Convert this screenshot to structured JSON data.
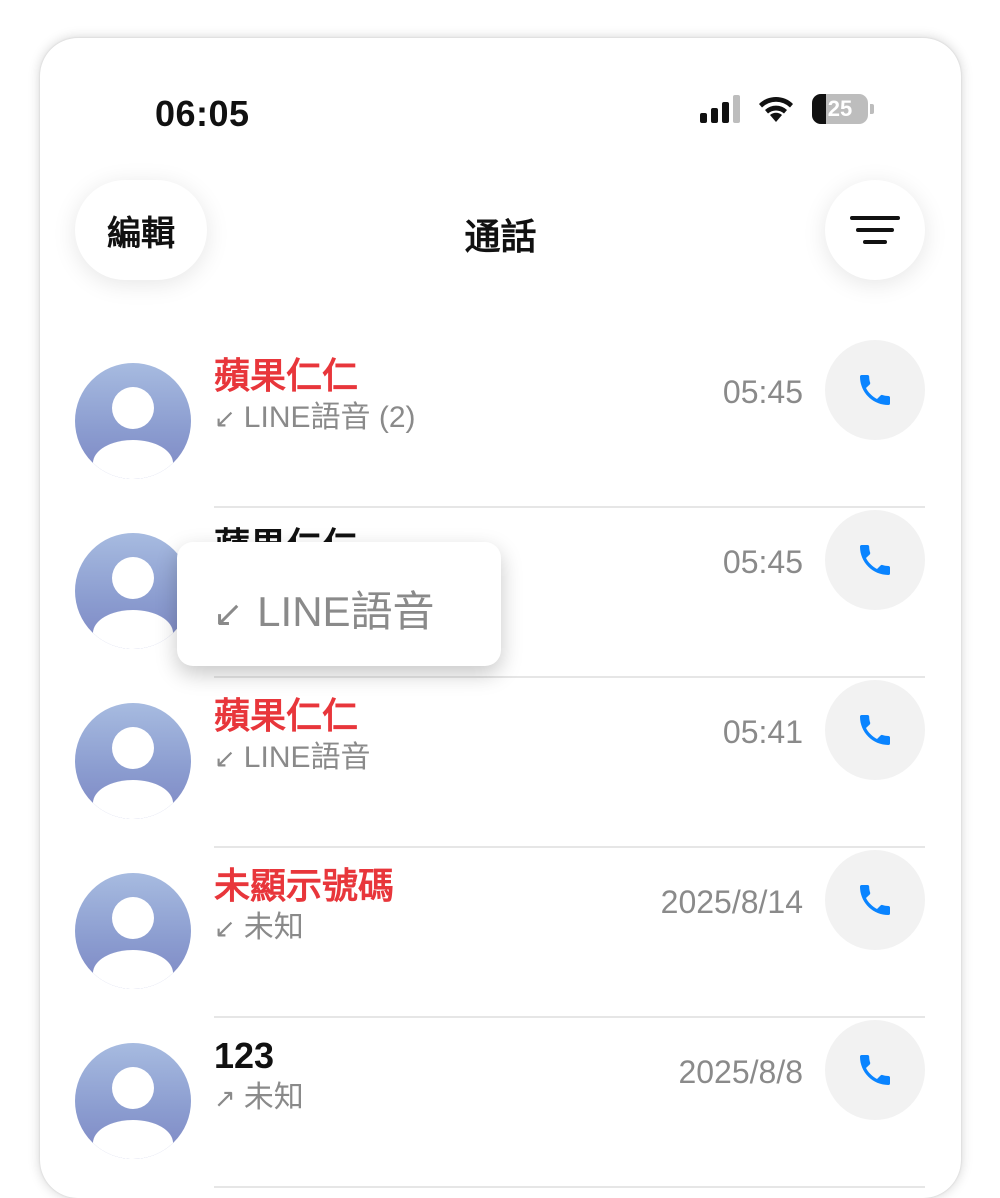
{
  "status_bar": {
    "time": "06:05",
    "battery": "25",
    "battery_level": 0.25
  },
  "header": {
    "edit_label": "編輯",
    "title": "通話"
  },
  "calls": [
    {
      "name": "蘋果仁仁",
      "name_color": "#e8363b",
      "direction": "↙",
      "detail": "LINE語音 (2)",
      "time": "05:45"
    },
    {
      "name": "蘋果仁仁",
      "name_color": "#111111",
      "direction": "↙",
      "detail": "LINE語音",
      "time": "05:45"
    },
    {
      "name": "蘋果仁仁",
      "name_color": "#e8363b",
      "direction": "↙",
      "detail": "LINE語音",
      "time": "05:41"
    },
    {
      "name": "未顯示號碼",
      "name_color": "#e8363b",
      "direction": "↙",
      "detail": "未知",
      "time": "2025/8/14"
    },
    {
      "name": "123",
      "name_color": "#111111",
      "direction": "↗",
      "detail": "未知",
      "time": "2025/8/8"
    }
  ],
  "tooltip": {
    "arrow": "↙",
    "text": "LINE語音"
  },
  "colors": {
    "accent": "#0a84ff",
    "missed": "#e8363b"
  }
}
